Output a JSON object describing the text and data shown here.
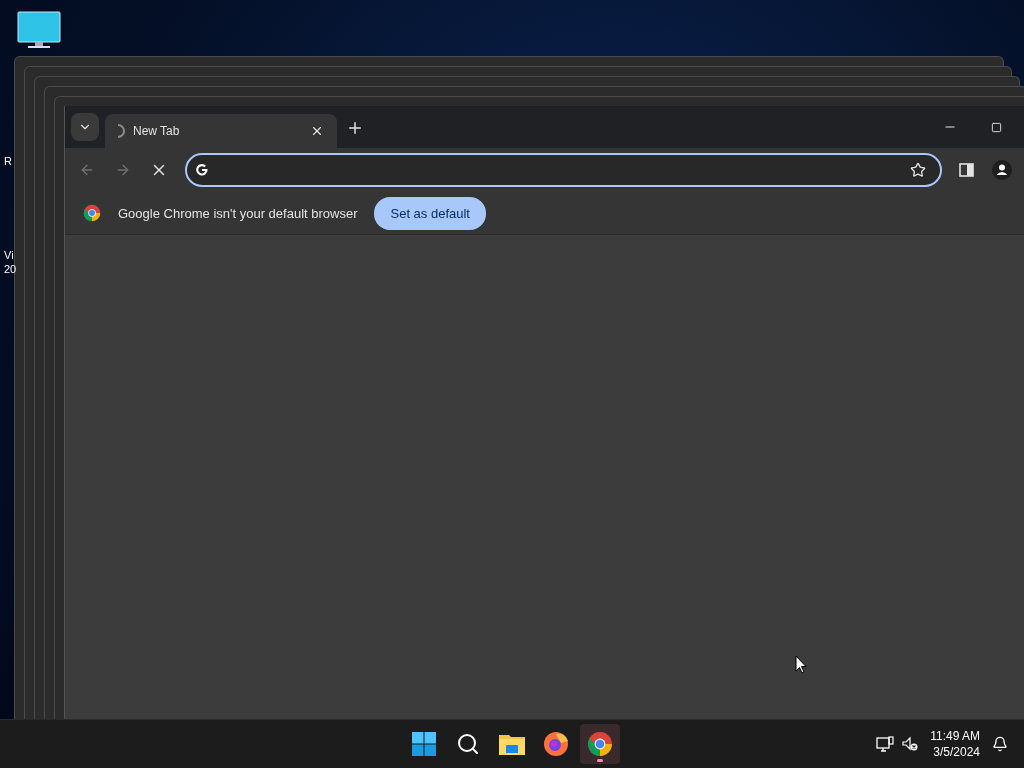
{
  "desktop": {
    "labels": [
      "R",
      "Vi",
      "20"
    ]
  },
  "browser": {
    "tabs": [
      {
        "title": "New Tab",
        "selected": true,
        "loading": true
      }
    ],
    "nav": [
      {
        "kind": "back",
        "disabled": true
      },
      {
        "kind": "forward",
        "disabled": true
      },
      {
        "kind": "stop",
        "disabled": false
      }
    ],
    "infobar": {
      "message": "Google Chrome isn't your default browser",
      "button": "Set as default"
    }
  },
  "taskbar": {
    "apps": [
      {
        "kind": "start",
        "active": false
      },
      {
        "kind": "search",
        "active": false
      },
      {
        "kind": "explorer",
        "active": false
      },
      {
        "kind": "firefox",
        "active": false
      },
      {
        "kind": "chrome",
        "active": true
      }
    ],
    "time": "11:49 AM",
    "date": "3/5/2024"
  }
}
